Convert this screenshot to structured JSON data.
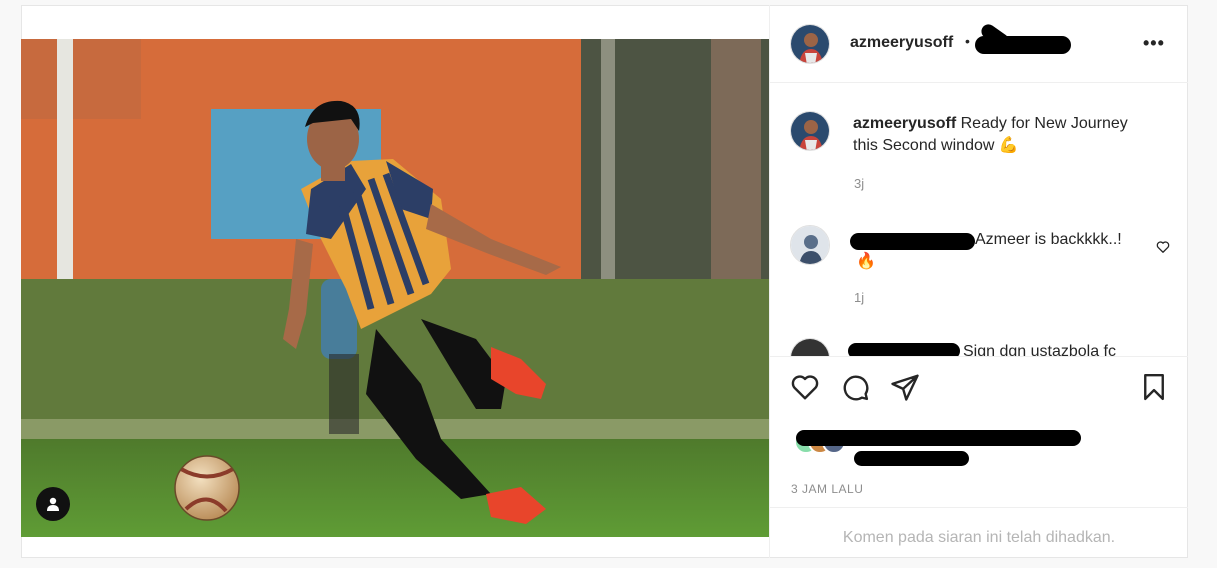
{
  "post": {
    "username": "azmeeryusoff",
    "header_separator": "•",
    "caption": "Ready for New Journey this Second window",
    "caption_emoji": "💪",
    "caption_time": "3j",
    "timestamp": "3 JAM LALU",
    "comments_disabled": "Komen pada siaran ini telah dihadkan."
  },
  "comments": [
    {
      "text": "Azmeer is backkkk..!",
      "emoji": "🔥",
      "time": "1j"
    },
    {
      "text": "Sign dgn ustazbola fc"
    }
  ],
  "icons": {
    "more": "more-options-icon",
    "like": "heart-icon",
    "comment": "comment-icon",
    "share": "share-icon",
    "save": "bookmark-icon",
    "tag": "user-tag-icon"
  },
  "colors": {
    "text": "#262626",
    "muted": "#8e8e8e",
    "border": "#efefef"
  }
}
